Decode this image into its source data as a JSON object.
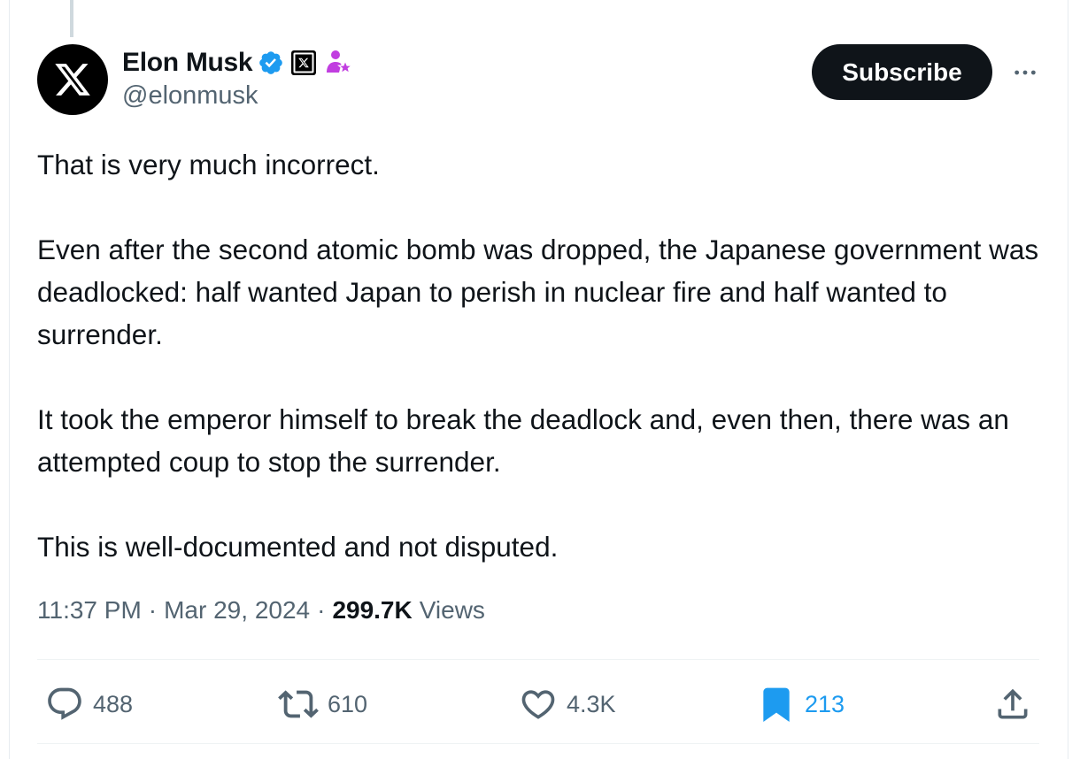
{
  "author": {
    "display_name": "Elon Musk",
    "handle": "@elonmusk",
    "avatar_icon": "x-logo-icon",
    "badges": [
      "verified-badge-icon",
      "x-affiliate-badge-icon",
      "subscriber-star-icon"
    ]
  },
  "header": {
    "subscribe_label": "Subscribe",
    "more_icon": "more-horizontal-icon"
  },
  "tweet": {
    "paragraphs": {
      "p1": "That is very much incorrect.",
      "p2": "Even after the second atomic bomb was dropped, the Japanese government was deadlocked: half wanted Japan to perish in nuclear fire and half wanted to surrender.",
      "p3": "It took the emperor himself to break the deadlock and, even then, there was an attempted coup to stop the surrender.",
      "p4": "This is well-documented and not disputed."
    }
  },
  "meta": {
    "time": "11:37 PM",
    "separator": "·",
    "date": "Mar 29, 2024",
    "views_count": "299.7K",
    "views_label": "Views"
  },
  "actions": {
    "reply": {
      "icon": "reply-icon",
      "count": "488"
    },
    "retweet": {
      "icon": "retweet-icon",
      "count": "610"
    },
    "like": {
      "icon": "heart-icon",
      "count": "4.3K"
    },
    "bookmark": {
      "icon": "bookmark-icon",
      "count": "213",
      "active": true
    },
    "share": {
      "icon": "share-icon"
    }
  },
  "colors": {
    "text_primary": "#0f1419",
    "text_secondary": "#536471",
    "verified_blue": "#1d9bf0",
    "subscriber_pink": "#c13ee0",
    "subscribe_button_bg": "#0f1419"
  }
}
